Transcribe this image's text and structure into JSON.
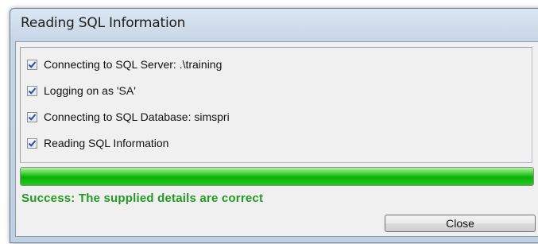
{
  "window": {
    "title": "Reading SQL Information"
  },
  "checklist": {
    "items": [
      {
        "label": "Connecting to SQL Server: .\\training",
        "checked": true
      },
      {
        "label": "Logging on as 'SA'",
        "checked": true
      },
      {
        "label": "Connecting to SQL Database: simspri",
        "checked": true
      },
      {
        "label": "Reading SQL Information",
        "checked": true
      }
    ]
  },
  "progress": {
    "value_percent": 100,
    "color": "#1fbf1a"
  },
  "status": {
    "message": "Success: The supplied details are correct",
    "color": "#229a22"
  },
  "buttons": {
    "close_label": "Close"
  }
}
